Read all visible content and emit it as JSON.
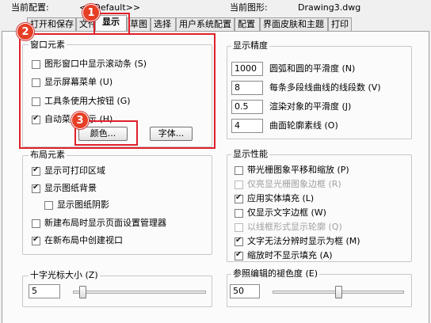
{
  "header": {
    "current_profile_label": "当前配置:",
    "current_profile_value": "<<Default>>",
    "current_drawing_label": "当前图形:",
    "current_drawing_value": "Drawing3.dwg"
  },
  "tabs": [
    {
      "label": "打开和保存"
    },
    {
      "label": "文件"
    },
    {
      "label": "显示"
    },
    {
      "label": "草图"
    },
    {
      "label": "选择"
    },
    {
      "label": "用户系统配置"
    },
    {
      "label": "配置"
    },
    {
      "label": "界面皮肤和主题"
    },
    {
      "label": "打印"
    }
  ],
  "window_elements": {
    "title": "窗口元素",
    "items": [
      {
        "label": "图形窗口中显示滚动条 (S)",
        "checked": false
      },
      {
        "label": "显示屏幕菜单 (U)",
        "checked": false
      },
      {
        "label": "工具条使用大按钮 (G)",
        "checked": false
      },
      {
        "label": "自动菜单显示 (H)",
        "checked": true
      }
    ],
    "color_button": "颜色...",
    "font_button": "字体..."
  },
  "layout_elements": {
    "title": "布局元素",
    "items": [
      {
        "label": "显示可打印区域",
        "checked": true
      },
      {
        "label": "显示图纸背景",
        "checked": true
      },
      {
        "label": "显示图纸阴影",
        "checked": false
      },
      {
        "label": "新建布局时显示页面设置管理器",
        "checked": false
      },
      {
        "label": "在新布局中创建视口",
        "checked": true
      }
    ]
  },
  "display_precision": {
    "title": "显示精度",
    "items": [
      {
        "value": "1000",
        "label": "圆弧和圆的平滑度 (N)"
      },
      {
        "value": "8",
        "label": "每条多段线曲线的线段数 (V)"
      },
      {
        "value": "0.5",
        "label": "渲染对象的平滑度 (J)"
      },
      {
        "value": "4",
        "label": "曲面轮廓素线 (O)"
      }
    ]
  },
  "display_performance": {
    "title": "显示性能",
    "items": [
      {
        "label": "带光栅图象平移和缩放 (P)",
        "checked": false,
        "disabled": false
      },
      {
        "label": "仅亮显光栅图象边框 (R)",
        "checked": false,
        "disabled": true
      },
      {
        "label": "应用实体填充 (L)",
        "checked": true,
        "disabled": false
      },
      {
        "label": "仅显示文字边框 (W)",
        "checked": false,
        "disabled": false
      },
      {
        "label": "以线框形式显示轮廓 (Q)",
        "checked": false,
        "disabled": true
      },
      {
        "label": "文字无法分辨时显示为框 (M)",
        "checked": true,
        "disabled": false
      },
      {
        "label": "缩放时不显示填充 (A)",
        "checked": true,
        "disabled": false
      }
    ]
  },
  "crosshair": {
    "title": "十字光标大小 (Z)",
    "value": "5",
    "slider_fraction": 0.05
  },
  "xref_fade": {
    "title": "参照编辑的褪色度 (E)",
    "value": "50",
    "slider_fraction": 0.5
  },
  "annotations": {
    "badge_1": "1",
    "badge_2": "2",
    "badge_3": "3",
    "accent_color": "#e0202a"
  }
}
